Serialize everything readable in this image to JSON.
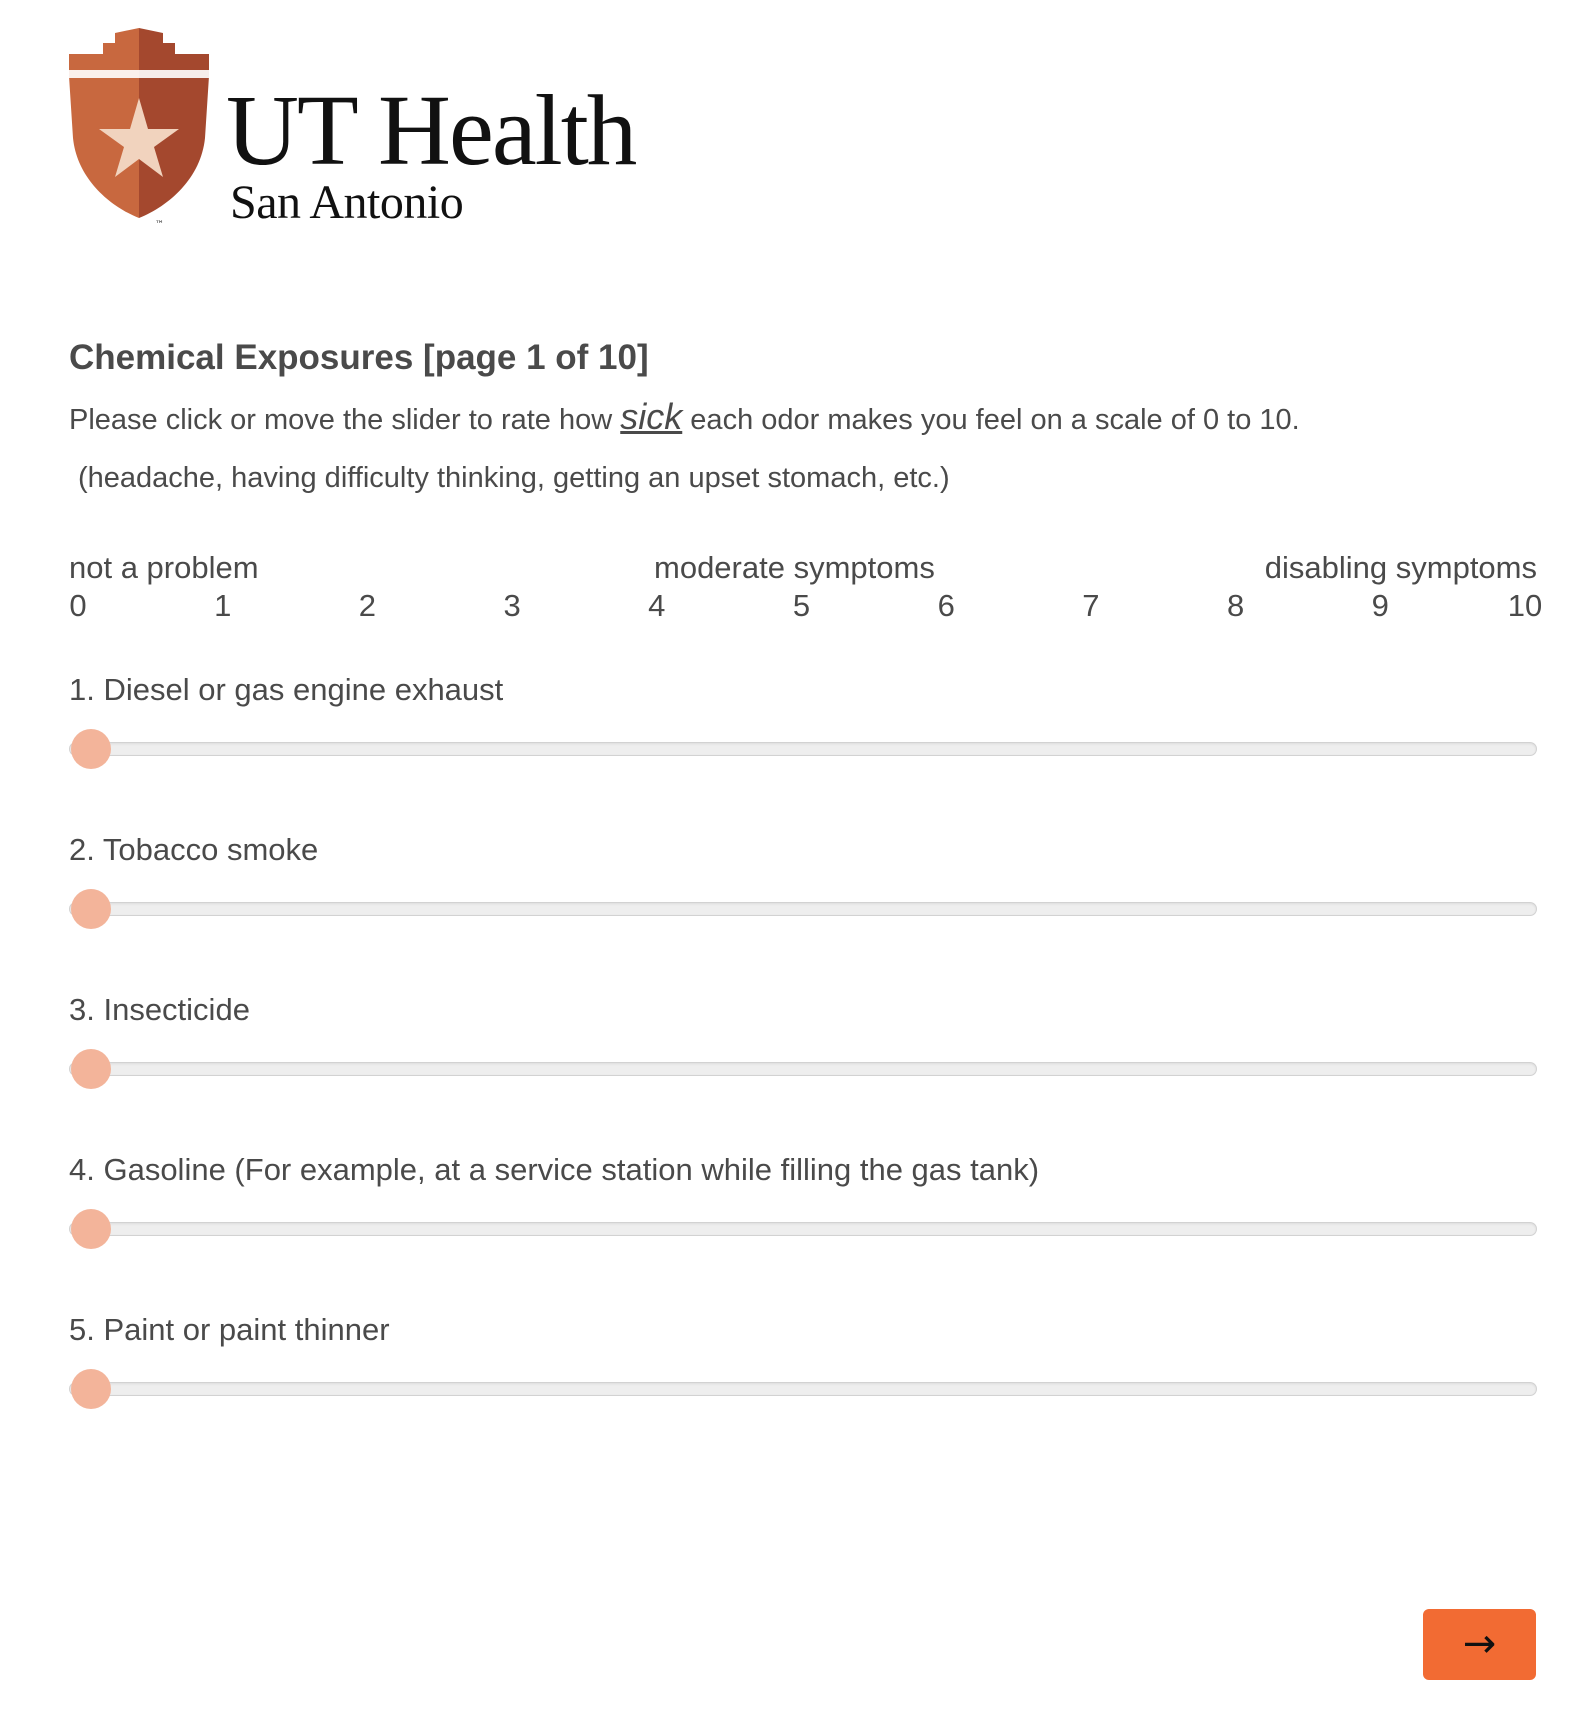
{
  "logo": {
    "main_text": "UT Health",
    "sub_text": "San Antonio",
    "trademark": "™",
    "colors": {
      "shield_light": "#c8683f",
      "shield_dark": "#a4482e",
      "star": "#f1d3be"
    }
  },
  "survey": {
    "title": "Chemical Exposures [page 1 of 10]",
    "instruction_before": "Please click or move the slider to rate how ",
    "instruction_emphasis": "sick",
    "instruction_after": " each odor makes you feel on a scale of 0 to 10.",
    "instruction_examples": "(headache, having difficulty thinking, getting an upset stomach, etc.)",
    "scale_labels": {
      "left": "not a problem",
      "middle": "moderate symptoms",
      "right": "disabling symptoms"
    },
    "ticks": [
      "0",
      "1",
      "2",
      "3",
      "4",
      "5",
      "6",
      "7",
      "8",
      "9",
      "10"
    ],
    "slider_min": 0,
    "slider_max": 10,
    "questions": [
      {
        "label": "1. Diesel or gas engine exhaust",
        "value": 0
      },
      {
        "label": "2. Tobacco smoke",
        "value": 0
      },
      {
        "label": "3. Insecticide",
        "value": 0
      },
      {
        "label": "4. Gasoline (For example, at a service station while filling the gas tank)",
        "value": 0
      },
      {
        "label": "5. Paint or paint thinner",
        "value": 0
      }
    ]
  },
  "navigation": {
    "next_label": "→",
    "next_color": "#f26b33"
  },
  "colors": {
    "text": "#4a4a4a",
    "slider_thumb": "#f3b49a",
    "slider_track": "#eeeeee"
  }
}
